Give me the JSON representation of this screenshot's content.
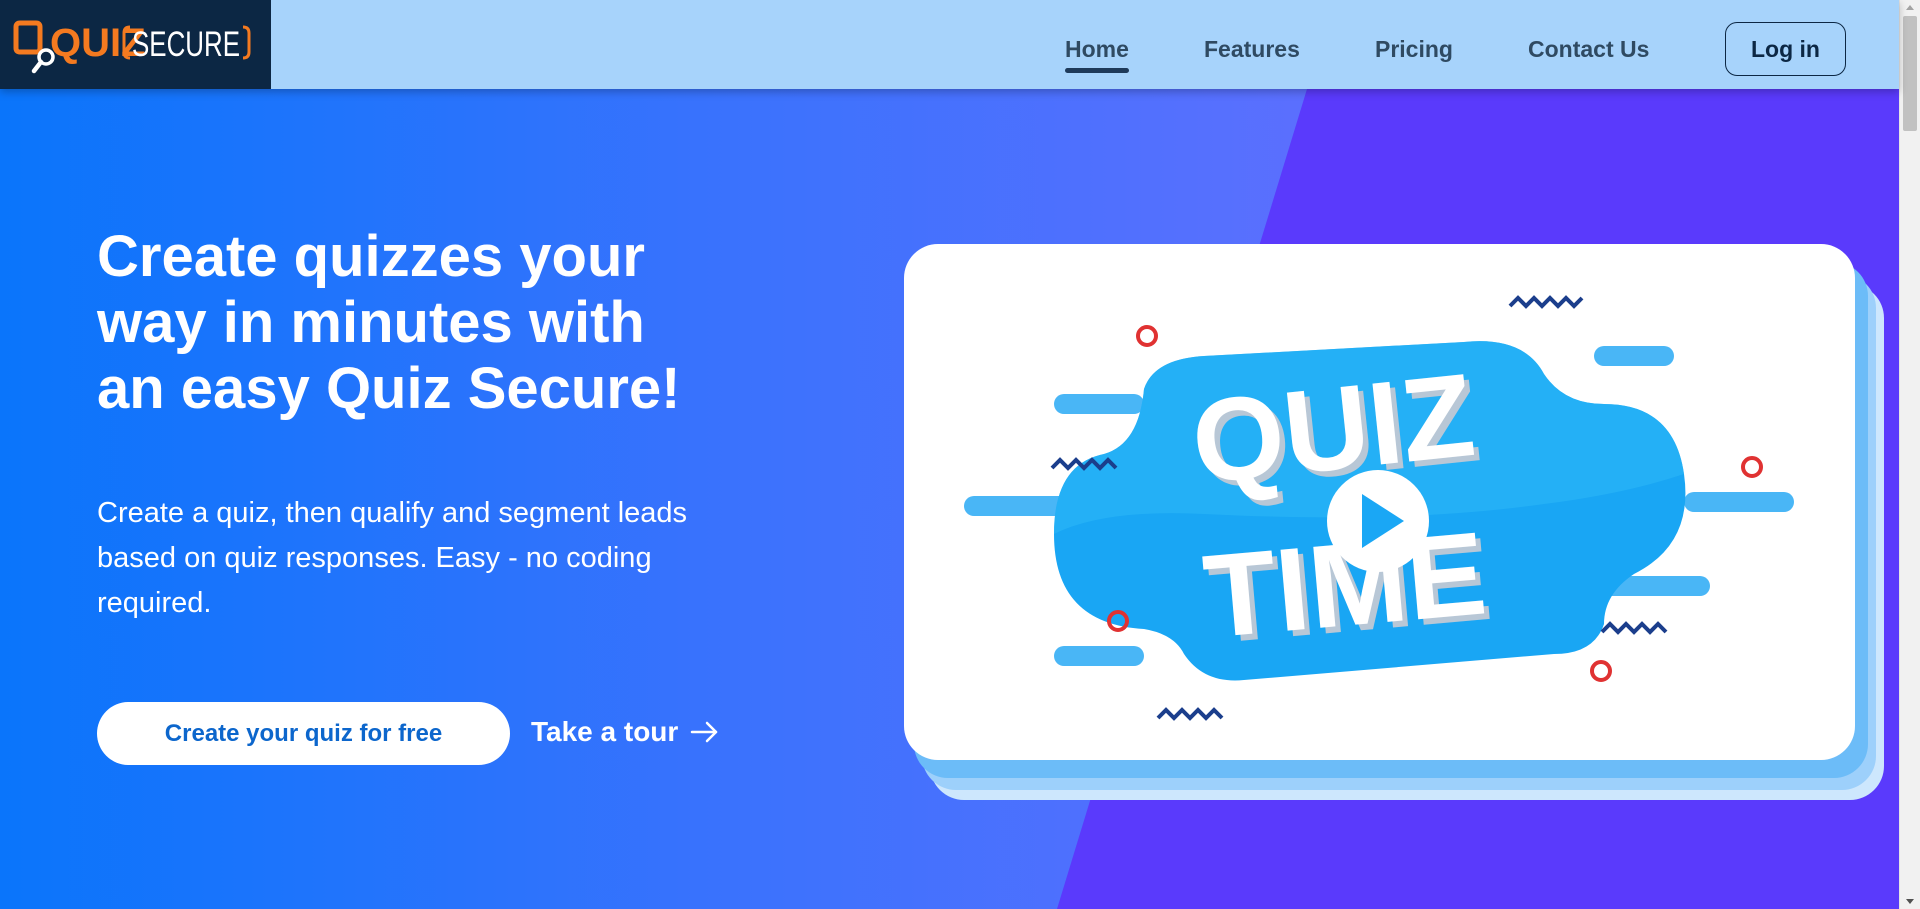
{
  "brand": {
    "name_part1": "QUIZ",
    "name_part2": "SECURE",
    "colors": {
      "orange": "#f47a20",
      "navy": "#0c2744"
    }
  },
  "nav": {
    "items": [
      {
        "label": "Home",
        "active": true
      },
      {
        "label": "Features",
        "active": false
      },
      {
        "label": "Pricing",
        "active": false
      },
      {
        "label": "Contact Us",
        "active": false
      }
    ],
    "login_label": "Log in"
  },
  "hero": {
    "title": "Create quizzes your way in minutes with an easy Quiz Secure!",
    "title_lines": [
      "Create quizzes your",
      "way in minutes with",
      "an easy Quiz Secure!"
    ],
    "subtitle_lines": [
      "Create a quiz, then qualify and segment leads",
      "based on quiz responses. Easy - no coding",
      "required."
    ],
    "cta_primary": "Create your quiz for free",
    "cta_secondary": "Take a tour",
    "cta_secondary_icon": "arrow-right-icon",
    "video": {
      "text_line1": "QUIZ",
      "text_line2": "TIME",
      "play_icon": "play-icon"
    }
  },
  "colors": {
    "header_bg": "#a7d3fb",
    "hero_gradient_start": "#0a75fb",
    "hero_purple": "#5a3afc",
    "cta_text": "#0c66cc",
    "card_blue": "#1aa7f5"
  }
}
